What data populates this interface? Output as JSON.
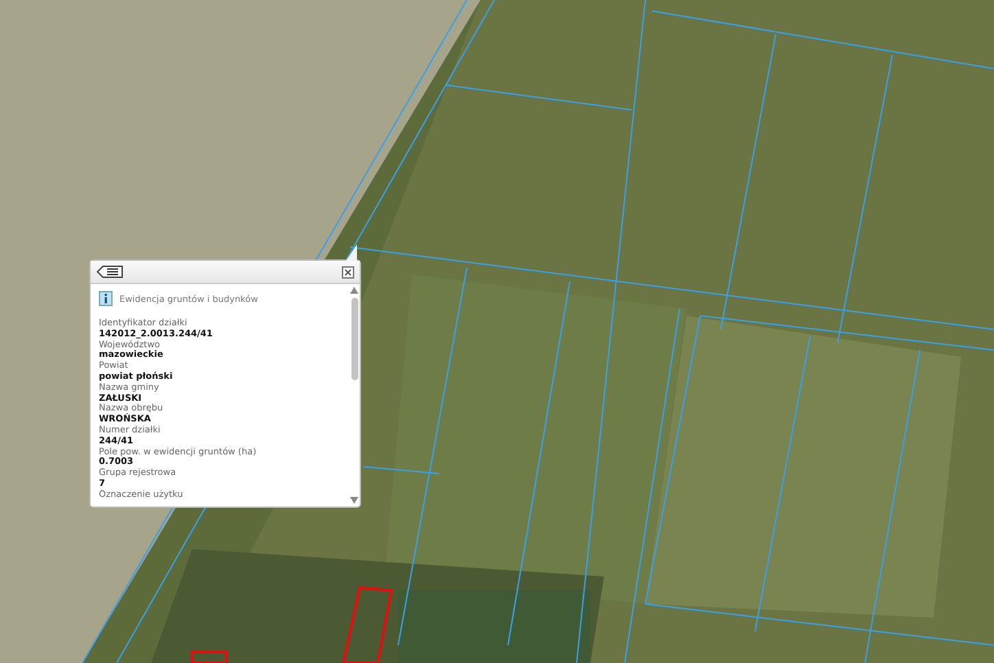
{
  "popup": {
    "title": "Ewidencja gruntów i budynków",
    "fields": [
      {
        "label": "Identyfikator działki",
        "value": "142012_2.0013.244/41"
      },
      {
        "label": "Województwo",
        "value": "mazowieckie"
      },
      {
        "label": "Powiat",
        "value": "powiat płoński"
      },
      {
        "label": "Nazwa gminy",
        "value": "ZAŁUSKI"
      },
      {
        "label": "Nazwa obrębu",
        "value": "WROŃSKA"
      },
      {
        "label": "Numer działki",
        "value": "244/41"
      },
      {
        "label": "Pole pow. w ewidencji gruntów (ha)",
        "value": "0.7003"
      },
      {
        "label": "Grupa rejestrowa",
        "value": "7"
      },
      {
        "label": "Oznaczenie użytku"
      }
    ]
  }
}
